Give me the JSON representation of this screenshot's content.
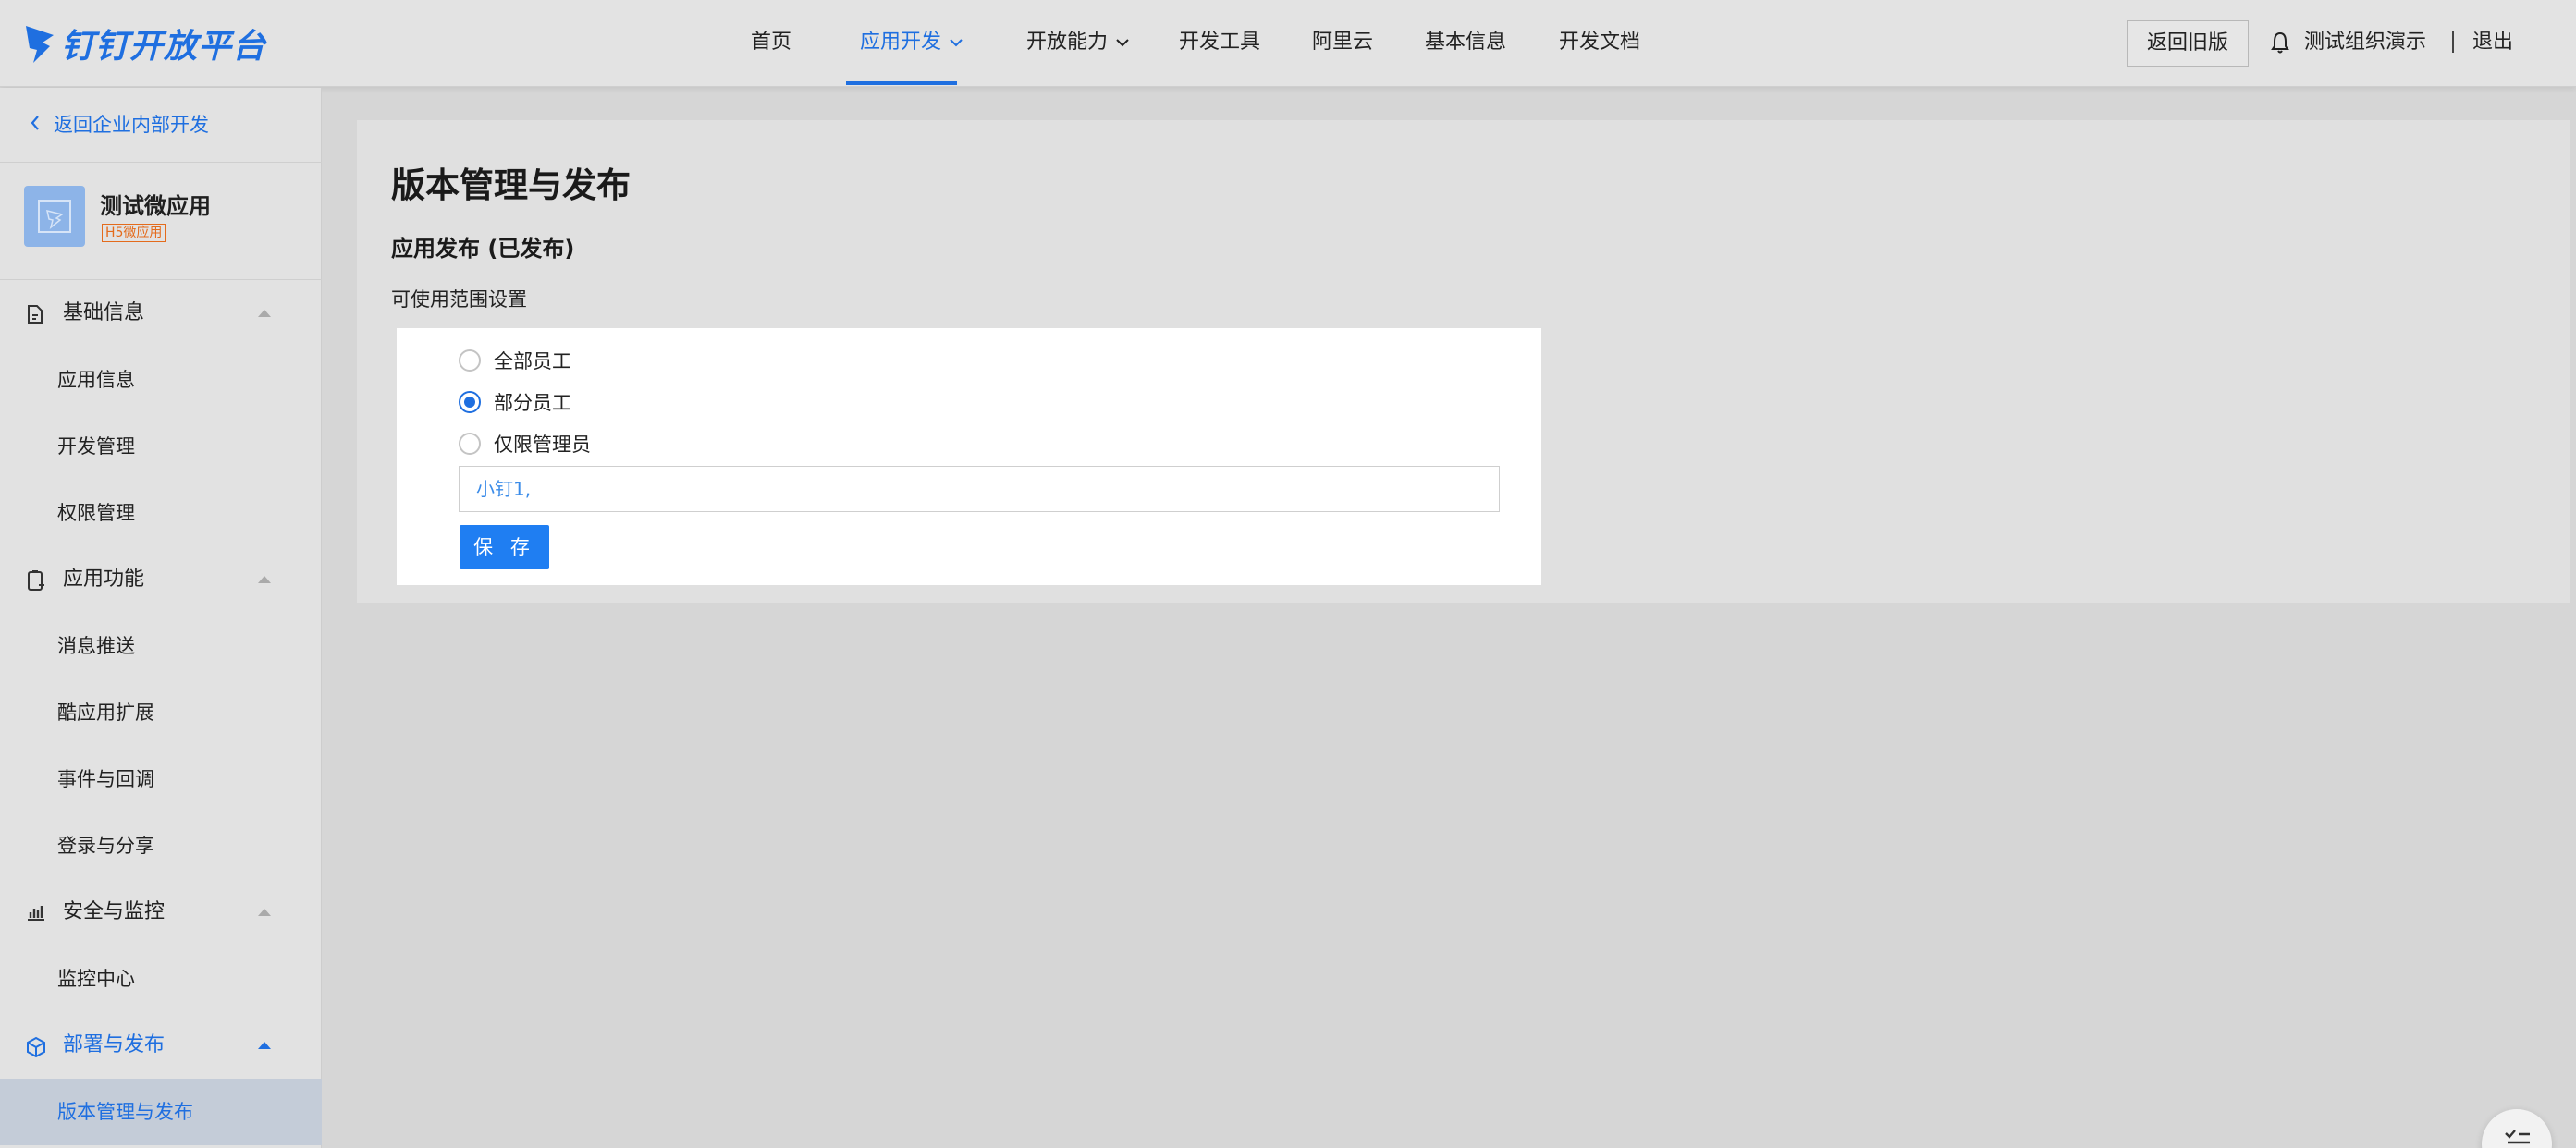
{
  "brand": {
    "name": "钉钉开放平台",
    "color": "#1f6fe0"
  },
  "nav": {
    "items": [
      {
        "label": "首页",
        "active": false,
        "dropdown": false
      },
      {
        "label": "应用开发",
        "active": true,
        "dropdown": true
      },
      {
        "label": "开放能力",
        "active": false,
        "dropdown": true
      },
      {
        "label": "开发工具",
        "active": false,
        "dropdown": false
      },
      {
        "label": "阿里云",
        "active": false,
        "dropdown": false
      },
      {
        "label": "基本信息",
        "active": false,
        "dropdown": false
      },
      {
        "label": "开发文档",
        "active": false,
        "dropdown": false
      }
    ],
    "old_version": "返回旧版",
    "org": "测试组织演示",
    "logout": "退出"
  },
  "sidebar": {
    "back": "返回企业内部开发",
    "app": {
      "name": "测试微应用",
      "badge": "H5微应用"
    },
    "groups": [
      {
        "label": "基础信息",
        "icon": "document-icon",
        "open": false,
        "items": [
          "应用信息",
          "开发管理",
          "权限管理"
        ]
      },
      {
        "label": "应用功能",
        "icon": "app-function-icon",
        "open": false,
        "items": [
          "消息推送",
          "酷应用扩展",
          "事件与回调",
          "登录与分享"
        ]
      },
      {
        "label": "安全与监控",
        "icon": "chart-icon",
        "open": false,
        "items": [
          "监控中心"
        ]
      },
      {
        "label": "部署与发布",
        "icon": "cube-icon",
        "open": true,
        "items": [
          "版本管理与发布"
        ]
      }
    ],
    "active_item": "版本管理与发布"
  },
  "main": {
    "title": "版本管理与发布",
    "section": "应用发布 (已发布)",
    "scope_label": "可使用范围设置",
    "options": [
      {
        "label": "全部员工",
        "checked": false
      },
      {
        "label": "部分员工",
        "checked": true
      },
      {
        "label": "仅限管理员",
        "checked": false
      }
    ],
    "selected_members": "小钉1,",
    "save": "保 存"
  },
  "colors": {
    "accent": "#1f6fe0",
    "badge": "#e46b1c",
    "button": "#1f7ef2"
  }
}
